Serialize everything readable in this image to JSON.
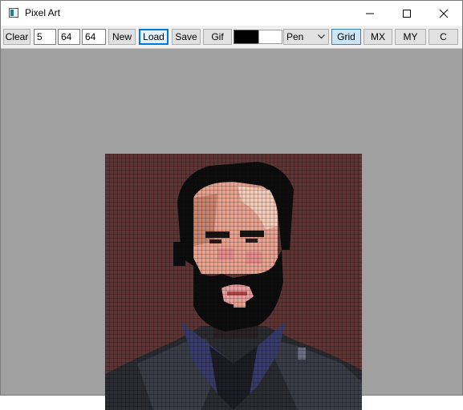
{
  "window": {
    "title": "Pixel Art",
    "icon": "pixel-art-app-icon",
    "controls": [
      "minimize-icon",
      "maximize-icon",
      "close-icon"
    ]
  },
  "toolbar": {
    "clear_label": "Clear",
    "pixel_size_value": "5",
    "width_value": "64",
    "height_value": "64",
    "new_label": "New",
    "load_label": "Load",
    "save_label": "Save",
    "gif_label": "Gif",
    "primary_color": "#000000",
    "secondary_color": "#ffffff",
    "tool_selected": "Pen",
    "grid_label": "Grid",
    "mx_label": "MX",
    "my_label": "MY",
    "c_label": "C"
  },
  "canvas": {
    "background_color": "#a0a0a0",
    "art_background_color": "#5e3535",
    "grid_enabled": true,
    "subject": "pixel portrait of a bearded man with dark hair in a dark suit"
  }
}
